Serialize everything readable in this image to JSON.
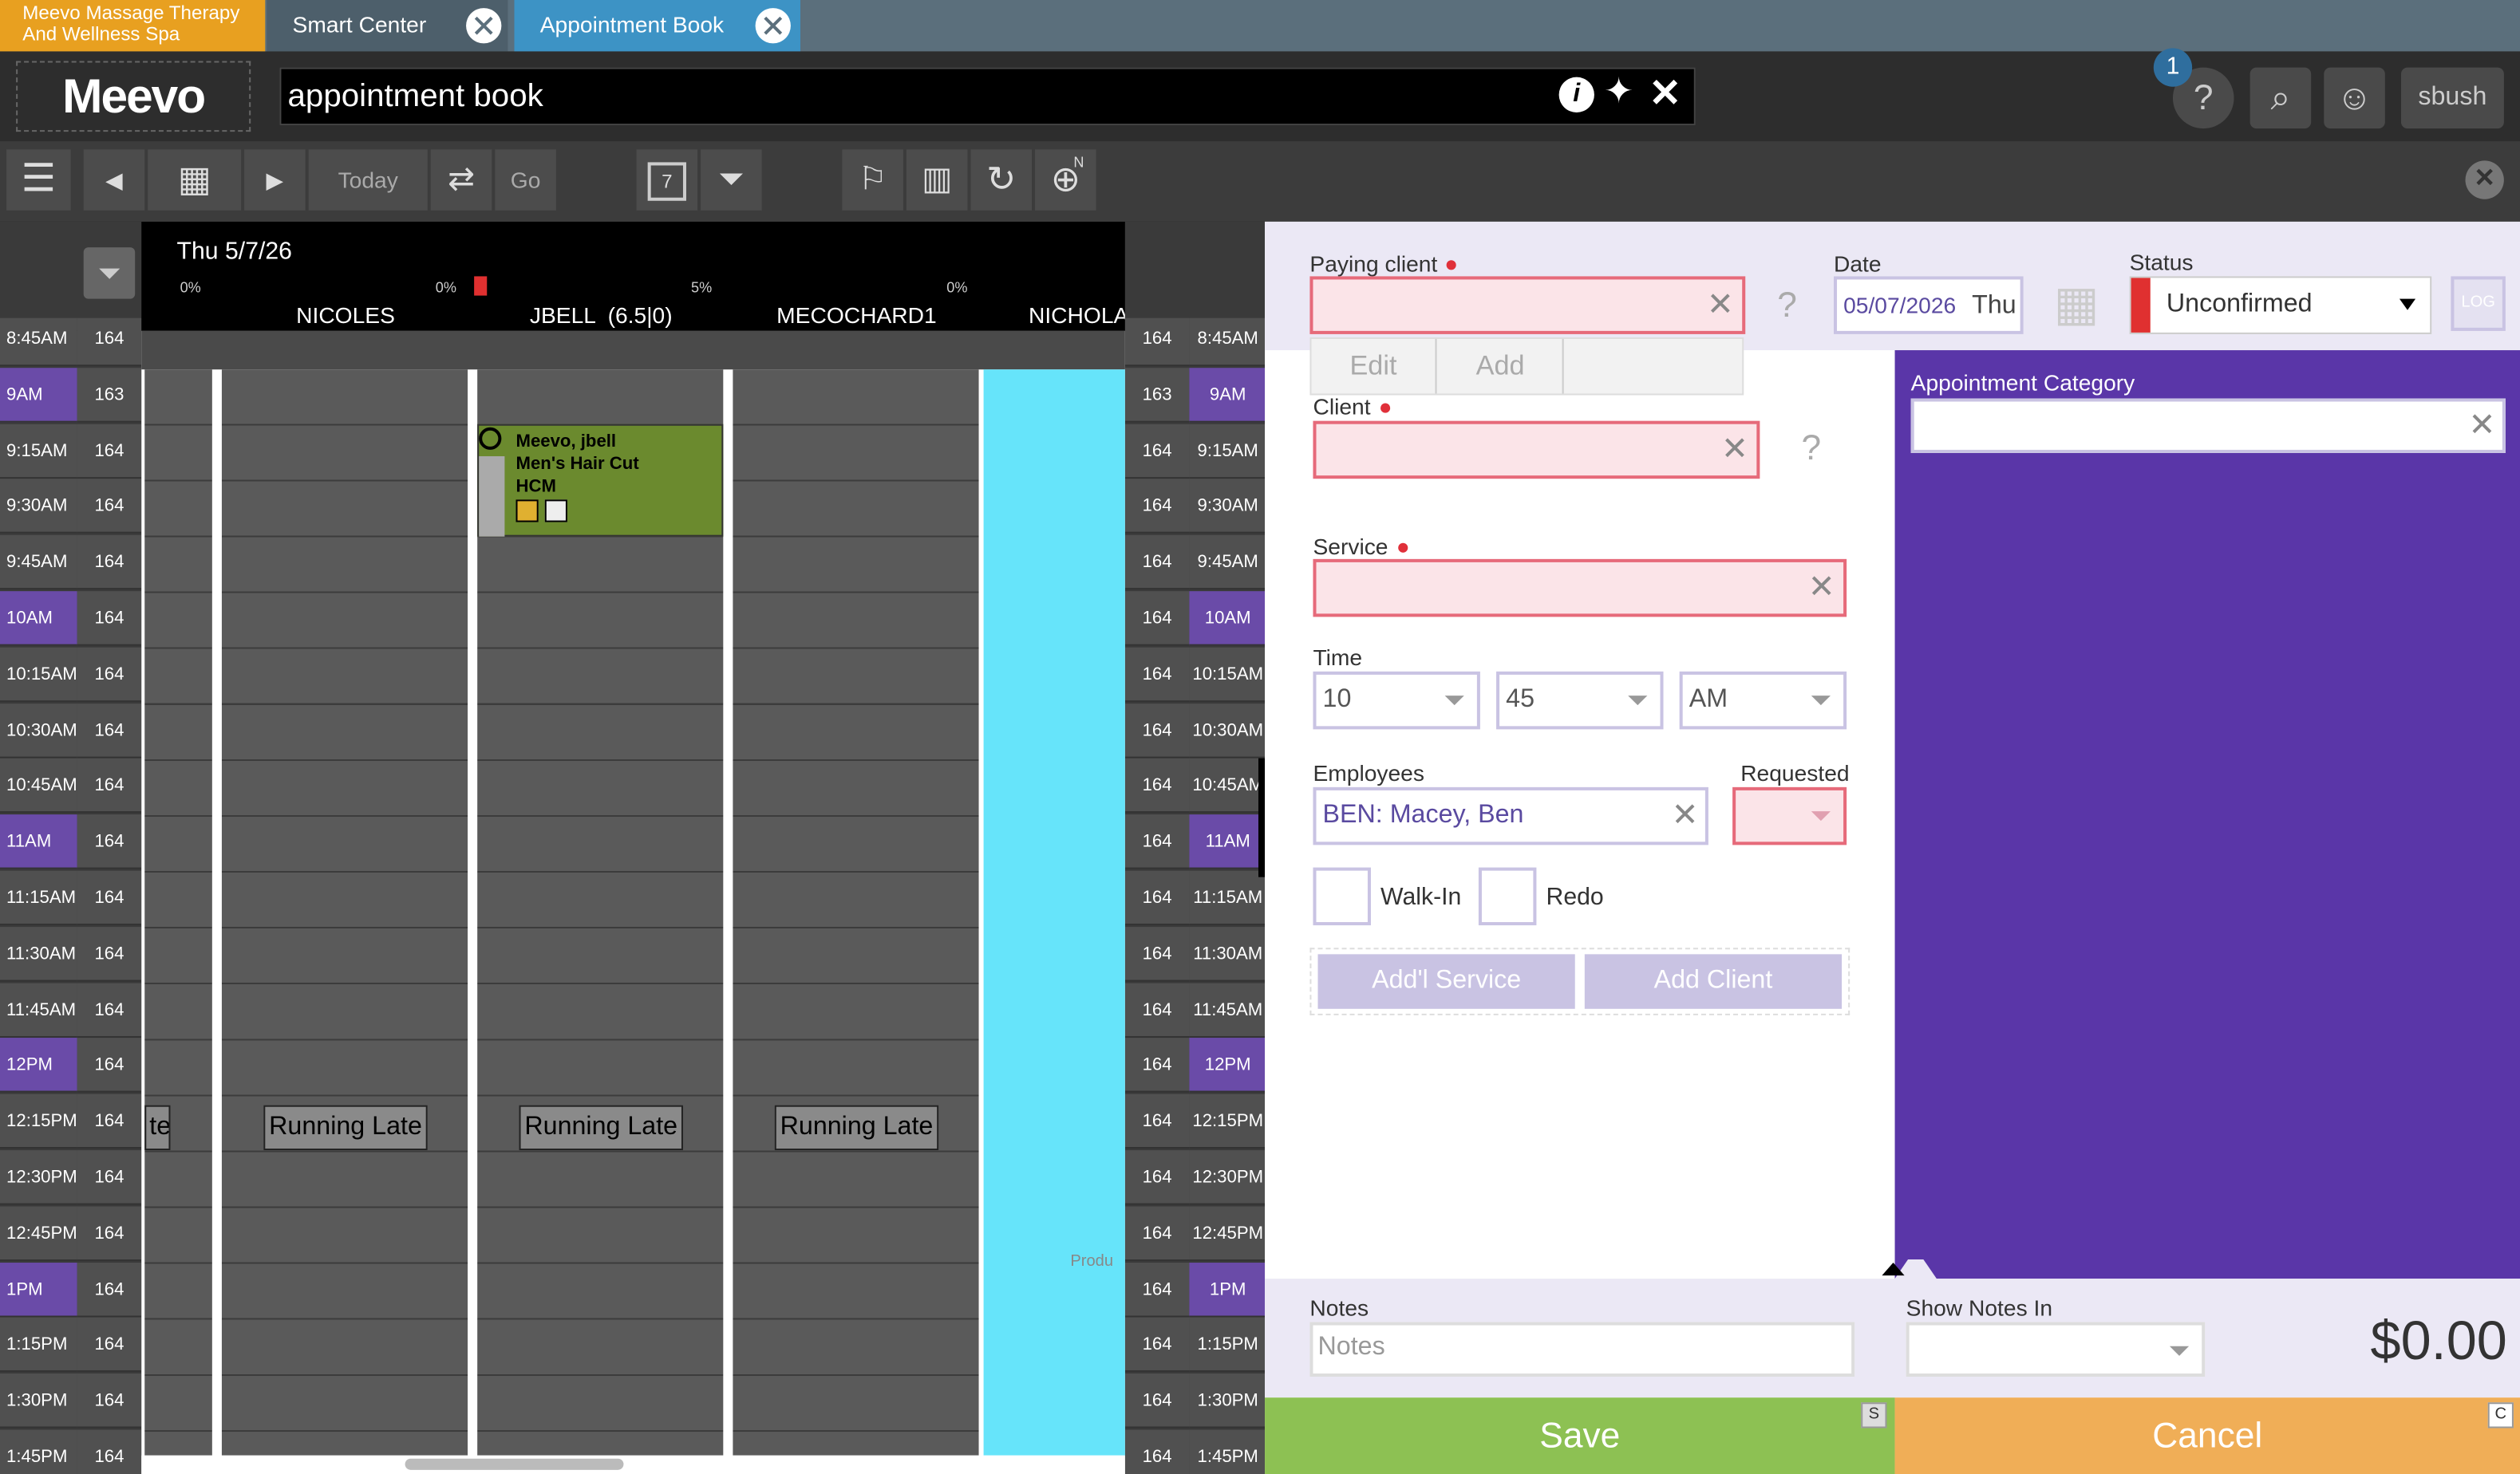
{
  "tabs": {
    "business": "Meevo Massage Therapy And Wellness Spa",
    "items": [
      {
        "label": "Smart Center"
      },
      {
        "label": "Appointment Book"
      }
    ]
  },
  "header": {
    "logo": "Meevo",
    "search_value": "appointment book",
    "notification_count": "1",
    "user": "sbush"
  },
  "toolbar": {
    "today": "Today",
    "go": "Go",
    "calendar_day": "7",
    "view_indicator": "N"
  },
  "calendar": {
    "date_label": "Thu 5/7/26",
    "columns": [
      {
        "name": "NICOLES",
        "pct": "0%"
      },
      {
        "name": "JBELL  (6.5|0)",
        "pct": "0%"
      },
      {
        "name": "MECOCHARD1",
        "pct": "5%"
      },
      {
        "name": "NICHOLA",
        "pct": "0%"
      }
    ],
    "times": [
      "8:45AM",
      "9AM",
      "9:15AM",
      "9:30AM",
      "9:45AM",
      "10AM",
      "10:15AM",
      "10:30AM",
      "10:45AM",
      "11AM",
      "11:15AM",
      "11:30AM",
      "11:45AM",
      "12PM",
      "12:15PM",
      "12:30PM",
      "12:45PM",
      "1PM",
      "1:15PM",
      "1:30PM",
      "1:45PM"
    ],
    "counts_left": [
      "164",
      "163",
      "164",
      "164",
      "164",
      "164",
      "164",
      "164",
      "164",
      "164",
      "164",
      "164",
      "164",
      "164",
      "164",
      "164",
      "164",
      "164",
      "164",
      "164",
      "164"
    ],
    "counts_right": [
      "164",
      "163",
      "164",
      "164",
      "164",
      "164",
      "164",
      "164",
      "164",
      "164",
      "164",
      "164",
      "164",
      "164",
      "164",
      "164",
      "164",
      "164",
      "164",
      "164",
      "164"
    ],
    "appointment": {
      "client": "Meevo, jbell",
      "service": "Men's Hair Cut",
      "code": "HCM"
    },
    "running_late": "Running Late",
    "running_late_partial": "te",
    "product_hint": "Produ"
  },
  "form": {
    "paying_client_label": "Paying client",
    "edit": "Edit",
    "add": "Add",
    "date_label": "Date",
    "date_value": "05/07/2026",
    "date_day": "Thu",
    "status_label": "Status",
    "status_value": "Unconfirmed",
    "log": "LOG",
    "client_label": "Client",
    "service_label": "Service",
    "time_label": "Time",
    "hour": "10",
    "minute": "45",
    "ampm": "AM",
    "employees_label": "Employees",
    "employee_value": "BEN: Macey, Ben",
    "requested_label": "Requested",
    "walkin": "Walk-In",
    "redo": "Redo",
    "add_service": "Add'l Service",
    "add_client": "Add Client",
    "category_label": "Appointment Category",
    "notes_label": "Notes",
    "notes_placeholder": "Notes",
    "show_notes_label": "Show Notes In",
    "total": "$0.00",
    "save": "Save",
    "save_key": "S",
    "cancel": "Cancel",
    "cancel_key": "C"
  },
  "colors": {
    "accent_purple": "#5a36a8",
    "save_green": "#8dc153",
    "cancel_orange": "#f0ae57",
    "status_red": "#e03030"
  }
}
